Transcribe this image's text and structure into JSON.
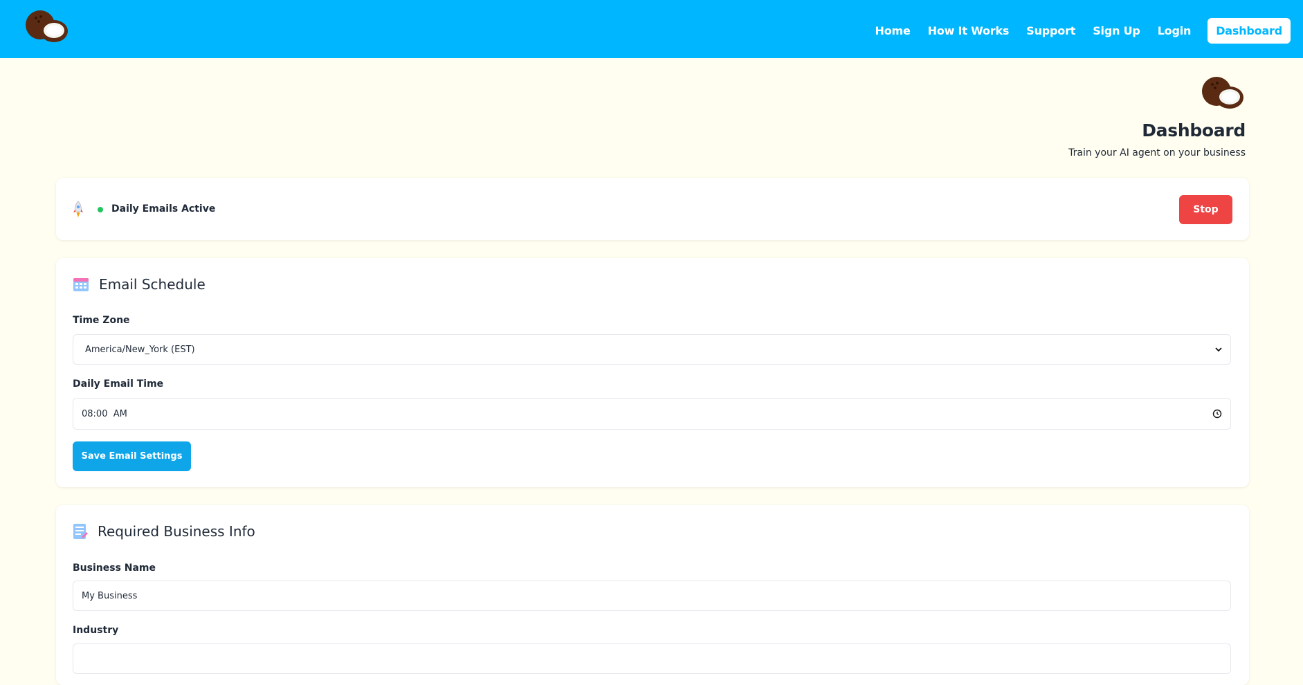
{
  "nav": {
    "items": [
      "Home",
      "How It Works",
      "Support",
      "Sign Up",
      "Login"
    ],
    "dashboard_button": "Dashboard"
  },
  "header": {
    "title": "Dashboard",
    "subtitle": "Train your AI agent on your business"
  },
  "status": {
    "icon": "rocket-icon",
    "indicator_color": "#22c55e",
    "text": "Daily Emails Active",
    "stop_button": "Stop"
  },
  "email_schedule": {
    "icon": "calendar-icon",
    "title": "Email Schedule",
    "timezone_label": "Time Zone",
    "timezone_value": "America/New_York (EST)",
    "time_label": "Daily Email Time",
    "time_value": "08:00  AM",
    "save_button": "Save Email Settings"
  },
  "business_info": {
    "icon": "notepad-icon",
    "title": "Required Business Info",
    "name_label": "Business Name",
    "name_value": "My Business",
    "industry_label": "Industry",
    "industry_value": ""
  },
  "colors": {
    "topbar": "#00b7ff",
    "background": "#fffef0",
    "stop": "#ef4444",
    "save": "#0ea5e9"
  }
}
